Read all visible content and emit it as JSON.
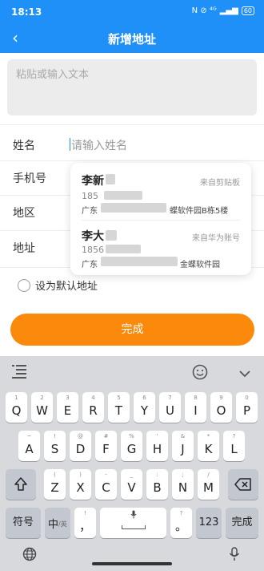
{
  "status": {
    "time": "18:13",
    "icons": "N ⊘ ⁴ᴳ",
    "battery": "60"
  },
  "nav": {
    "back_icon": "back-arrow-icon",
    "title": "新增地址"
  },
  "paste": {
    "placeholder": "粘贴或输入文本"
  },
  "form": {
    "name_label": "姓名",
    "name_placeholder": "请输入姓名",
    "phone_label": "手机号",
    "region_label": "地区",
    "address_label": "地址"
  },
  "suggestions": [
    {
      "name": "李新",
      "source": "来自剪贴板",
      "phone": "185",
      "address_prefix": "广东",
      "address_suffix": "蝶软件园B栋5楼"
    },
    {
      "name": "李大",
      "source": "来自华为账号",
      "phone": "1856",
      "address_prefix": "广东",
      "address_suffix": "金蝶软件园"
    }
  ],
  "default": {
    "label": "设为默认地址"
  },
  "submit": {
    "label": "完成"
  },
  "keyboard": {
    "toolbar": {
      "left_icon": "keyboard-menu-icon",
      "emoji_icon": "emoji-icon",
      "collapse_icon": "chevron-down-icon"
    },
    "row1": [
      {
        "k": "Q",
        "s": "1"
      },
      {
        "k": "W",
        "s": "2"
      },
      {
        "k": "E",
        "s": "3"
      },
      {
        "k": "R",
        "s": "4"
      },
      {
        "k": "T",
        "s": "5"
      },
      {
        "k": "Y",
        "s": "6"
      },
      {
        "k": "U",
        "s": "7"
      },
      {
        "k": "I",
        "s": "8"
      },
      {
        "k": "O",
        "s": "9"
      },
      {
        "k": "P",
        "s": "0"
      }
    ],
    "row2": [
      {
        "k": "A",
        "s": "~"
      },
      {
        "k": "S",
        "s": "!"
      },
      {
        "k": "D",
        "s": "@"
      },
      {
        "k": "F",
        "s": "#"
      },
      {
        "k": "G",
        "s": "%"
      },
      {
        "k": "H",
        "s": "'"
      },
      {
        "k": "J",
        "s": "&"
      },
      {
        "k": "K",
        "s": "*"
      },
      {
        "k": "L",
        "s": "?"
      }
    ],
    "row3": [
      {
        "k": "Z",
        "s": "("
      },
      {
        "k": "X",
        "s": ")"
      },
      {
        "k": "C",
        "s": "-"
      },
      {
        "k": "V",
        "s": "_"
      },
      {
        "k": "B",
        "s": ":"
      },
      {
        "k": "N",
        "s": ";"
      },
      {
        "k": "M",
        "s": "/"
      }
    ],
    "shift_icon": "shift-icon",
    "delete_icon": "backspace-icon",
    "symbols_label": "符号",
    "lang_label": "中",
    "lang_sub": "/英",
    "comma_label": "，",
    "comma_sub": "!",
    "period_label": "。",
    "period_sub": "?",
    "mic_icon": "microphone-icon",
    "num_label": "123",
    "done_label": "完成",
    "globe_icon": "globe-icon",
    "voice_icon": "microphone-icon"
  },
  "colors": {
    "primary": "#1e90f7",
    "accent": "#fb8a0c"
  }
}
